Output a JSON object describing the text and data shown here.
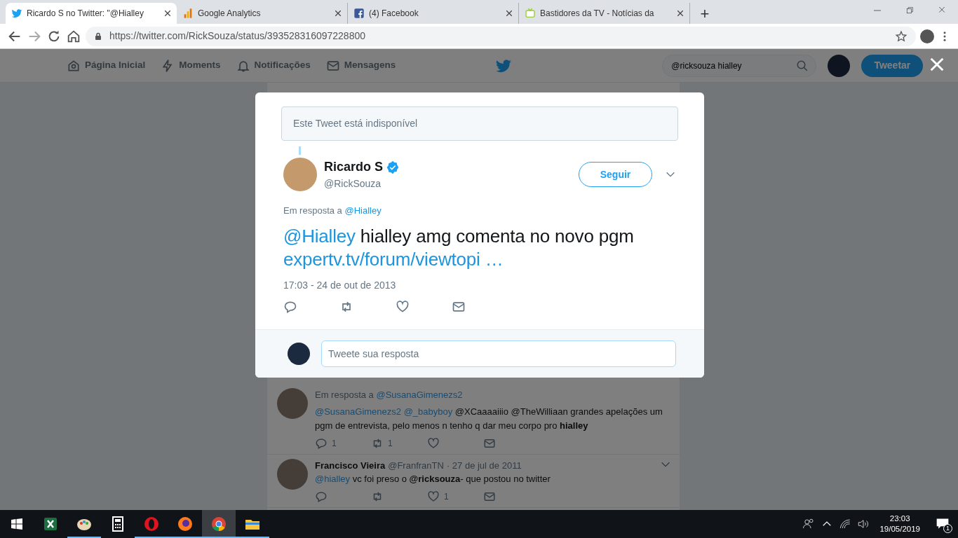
{
  "browser": {
    "tabs": [
      {
        "title": "Ricardo S no Twitter: \"@Hialley",
        "kind": "twitter",
        "selected": true
      },
      {
        "title": "Google Analytics",
        "kind": "analytics",
        "selected": false
      },
      {
        "title": "(4) Facebook",
        "kind": "facebook",
        "selected": false
      },
      {
        "title": "Bastidores da TV - Notícias da",
        "kind": "tv",
        "selected": false
      }
    ],
    "new_tab": "+",
    "address": "https://twitter.com/RickSouza/status/393528316097228800"
  },
  "nav": {
    "items": [
      {
        "label": "Página Inicial",
        "kind": "home"
      },
      {
        "label": "Moments",
        "kind": "moments"
      },
      {
        "label": "Notificações",
        "kind": "notifications"
      },
      {
        "label": "Mensagens",
        "kind": "messages"
      }
    ],
    "search": {
      "value": "@ricksouza hialley"
    },
    "tweet_button": "Tweetar"
  },
  "timeline": [
    {
      "reply_to": {
        "prefix": "Em resposta a",
        "mention": "@SusanaGimenezs2"
      },
      "text": [
        {
          "kind": "mention",
          "text": "@SusanaGimenezs2"
        },
        {
          "kind": "mention",
          "text": "@_babyboy"
        },
        {
          "kind": "text",
          "text": " @XCaaaaiiio @TheWilliaan grandes apelações um pgm de entrevista, pelo menos n tenho q dar meu corpo pro "
        },
        {
          "kind": "bold",
          "text": "hialley"
        }
      ],
      "actions": [
        {
          "kind": "reply",
          "count": "1"
        },
        {
          "kind": "retweet",
          "count": "1"
        },
        {
          "kind": "like"
        },
        {
          "kind": "dm"
        }
      ]
    },
    {
      "name": "Francisco Vieira",
      "handle": "@FranfranTN",
      "date": "· 27 de jul de 2011",
      "text": [
        {
          "kind": "mention",
          "text": "@hialley"
        },
        {
          "kind": "text",
          "text": " vc foi preso o "
        },
        {
          "kind": "bold",
          "text": "@ricksouza"
        },
        {
          "kind": "text",
          "text": "- que postou no twitter"
        }
      ],
      "actions": [
        {
          "kind": "reply"
        },
        {
          "kind": "retweet"
        },
        {
          "kind": "like",
          "count": "1"
        },
        {
          "kind": "dm"
        }
      ]
    }
  ],
  "modal": {
    "unavailable": "Este Tweet está indisponível",
    "author": {
      "name": "Ricardo S",
      "verified": true,
      "handle": "@RickSouza"
    },
    "follow_button": "Seguir",
    "reply_to": {
      "prefix": "Em resposta a",
      "mention": "@Hialley"
    },
    "text": [
      {
        "kind": "mention",
        "text": "@Hialley"
      },
      {
        "kind": "text",
        "text": " hialley amg comenta no novo pgm "
      },
      {
        "kind": "mention",
        "text": "expertv.tv/forum/viewtopi …"
      }
    ],
    "timestamp": "17:03 - 24 de out de 2013",
    "actions": [
      {
        "kind": "reply"
      },
      {
        "kind": "retweet"
      },
      {
        "kind": "like"
      },
      {
        "kind": "dm"
      }
    ],
    "reply": {
      "placeholder": "Tweete sua resposta"
    }
  },
  "taskbar": {
    "apps": [
      {
        "kind": "excel",
        "running": false,
        "active": false
      },
      {
        "kind": "paint",
        "running": true,
        "active": false
      },
      {
        "kind": "calculator",
        "running": false,
        "active": false
      },
      {
        "kind": "opera",
        "running": true,
        "active": false
      },
      {
        "kind": "firefox",
        "running": true,
        "active": false
      },
      {
        "kind": "chrome",
        "running": true,
        "active": true
      },
      {
        "kind": "files",
        "running": true,
        "active": false
      }
    ],
    "time": "23:03",
    "date": "19/05/2019",
    "notifications": "1"
  }
}
